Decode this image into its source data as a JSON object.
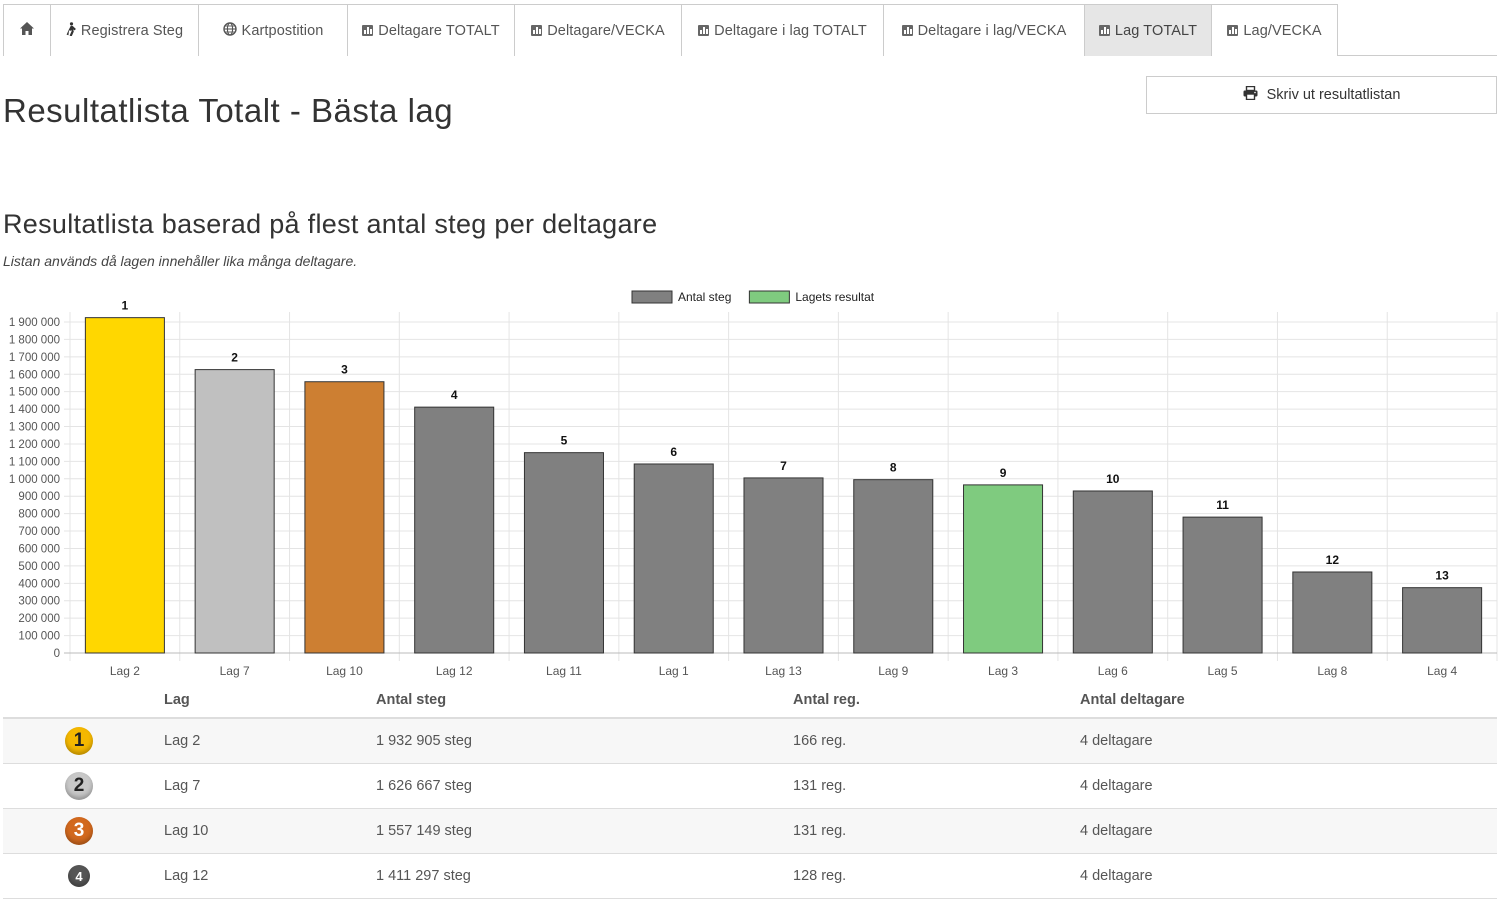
{
  "tabs": [
    {
      "label": "",
      "icon": "home-icon",
      "active": false
    },
    {
      "label": "Registrera Steg",
      "icon": "walking-icon",
      "active": false
    },
    {
      "label": "Kartpostition",
      "icon": "globe-icon",
      "active": false
    },
    {
      "label": "Deltagare TOTALT",
      "icon": "bar-chart-icon",
      "active": false
    },
    {
      "label": "Deltagare/VECKA",
      "icon": "bar-chart-icon",
      "active": false
    },
    {
      "label": "Deltagare i lag TOTALT",
      "icon": "bar-chart-icon",
      "active": false
    },
    {
      "label": "Deltagare i lag/VECKA",
      "icon": "bar-chart-icon",
      "active": false
    },
    {
      "label": "Lag TOTALT",
      "icon": "bar-chart-icon",
      "active": true
    },
    {
      "label": "Lag/VECKA",
      "icon": "bar-chart-icon",
      "active": false
    }
  ],
  "page": {
    "title": "Resultatlista Totalt - Bästa lag",
    "print_label": "Skriv ut resultatlistan",
    "subtitle": "Resultatlista baserad på flest antal steg per deltagare",
    "note": "Listan används då lagen innehåller lika många deltagare."
  },
  "colors": {
    "gold": "#ffd700",
    "silver": "#c0c0c0",
    "bronze": "#cd7f32",
    "default_bar": "#808080",
    "team_result": "#7fcb7f",
    "medal_gold": "#f5b800",
    "medal_silver": "#c8c8c8",
    "medal_bronze": "#d2691e",
    "medal_other": "#555555"
  },
  "chart_data": {
    "type": "bar",
    "legend": [
      {
        "name": "Antal steg",
        "color": "#808080"
      },
      {
        "name": "Lagets resultat",
        "color": "#7fcb7f"
      }
    ],
    "legend_position": "top",
    "grid": true,
    "categories": [
      "Lag 2",
      "Lag 7",
      "Lag 10",
      "Lag 12",
      "Lag 11",
      "Lag 1",
      "Lag 13",
      "Lag 9",
      "Lag 3",
      "Lag 6",
      "Lag 5",
      "Lag 8",
      "Lag 4"
    ],
    "values": [
      1932905,
      1626667,
      1557149,
      1411297,
      1150000,
      1085000,
      1005000,
      995000,
      965000,
      930000,
      780000,
      465000,
      375000
    ],
    "ranks": [
      "1",
      "2",
      "3",
      "4",
      "5",
      "6",
      "7",
      "8",
      "9",
      "10",
      "11",
      "12",
      "13"
    ],
    "bar_colors": [
      "#ffd700",
      "#c0c0c0",
      "#cd7f32",
      "#808080",
      "#808080",
      "#808080",
      "#808080",
      "#808080",
      "#7fcb7f",
      "#808080",
      "#808080",
      "#808080",
      "#808080"
    ],
    "ylim": [
      0,
      1900000
    ],
    "y_ticks": [
      {
        "value": 0,
        "label": "0"
      },
      {
        "value": 100000,
        "label": "100 000"
      },
      {
        "value": 200000,
        "label": "200 000"
      },
      {
        "value": 300000,
        "label": "300 000"
      },
      {
        "value": 400000,
        "label": "400 000"
      },
      {
        "value": 500000,
        "label": "500 000"
      },
      {
        "value": 600000,
        "label": "600 000"
      },
      {
        "value": 700000,
        "label": "700 000"
      },
      {
        "value": 800000,
        "label": "800 000"
      },
      {
        "value": 900000,
        "label": "900 000"
      },
      {
        "value": 1000000,
        "label": "1 000 000"
      },
      {
        "value": 1100000,
        "label": "1 100 000"
      },
      {
        "value": 1200000,
        "label": "1 200 000"
      },
      {
        "value": 1300000,
        "label": "1 300 000"
      },
      {
        "value": 1400000,
        "label": "1 400 000"
      },
      {
        "value": 1500000,
        "label": "1 500 000"
      },
      {
        "value": 1600000,
        "label": "1 600 000"
      },
      {
        "value": 1700000,
        "label": "1 700 000"
      },
      {
        "value": 1800000,
        "label": "1 800 000"
      },
      {
        "value": 1900000,
        "label": "1 900 000"
      }
    ]
  },
  "table": {
    "headers": {
      "lag": "Lag",
      "steg": "Antal steg",
      "reg": "Antal reg.",
      "deltagare": "Antal deltagare"
    },
    "rows": [
      {
        "rank": "1",
        "lag": "Lag 2",
        "steg": "1 932 905 steg",
        "reg": "166 reg.",
        "deltagare": "4 deltagare"
      },
      {
        "rank": "2",
        "lag": "Lag 7",
        "steg": "1 626 667 steg",
        "reg": "131 reg.",
        "deltagare": "4 deltagare"
      },
      {
        "rank": "3",
        "lag": "Lag 10",
        "steg": "1 557 149 steg",
        "reg": "131 reg.",
        "deltagare": "4 deltagare"
      },
      {
        "rank": "4",
        "lag": "Lag 12",
        "steg": "1 411 297 steg",
        "reg": "128 reg.",
        "deltagare": "4 deltagare"
      }
    ]
  }
}
